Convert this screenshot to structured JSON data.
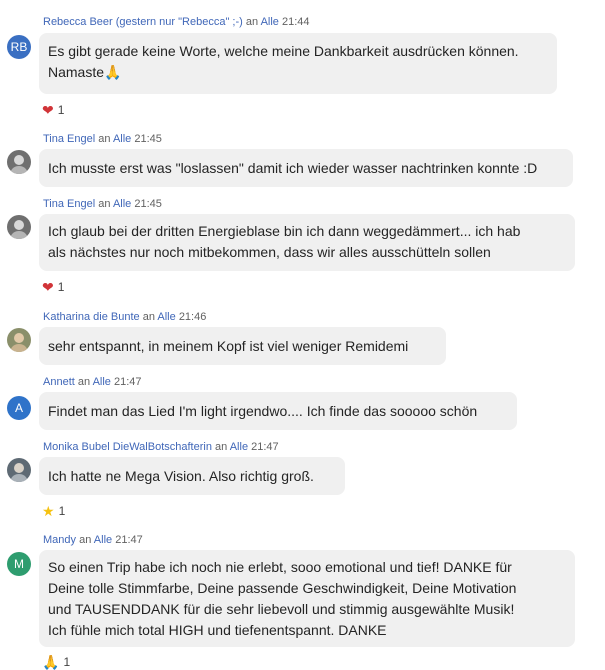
{
  "messages": [
    {
      "avatar_initials": "RB",
      "avatar_color": "#3a6fc2",
      "name": "Rebecca Beer (gestern nur \"Rebecca\" ;-)",
      "sep": "an",
      "audience": "Alle",
      "time": "21:44",
      "lines": [
        "Es gibt gerade keine Worte, welche meine Dankbarkeit ausdrücken können.",
        "Namaste🙏"
      ],
      "reaction_icon": "heart-icon",
      "reaction_glyph": "❤",
      "reaction_count": "1"
    },
    {
      "avatar_initials": "",
      "name": "Tina Engel",
      "sep": "an",
      "audience": "Alle",
      "time": "21:45",
      "lines": [
        "Ich musste erst was \"loslassen\" damit ich wieder wasser nachtrinken konnte :D"
      ]
    },
    {
      "avatar_initials": "",
      "name": "Tina Engel",
      "sep": "an",
      "audience": "Alle",
      "time": "21:45",
      "lines": [
        "Ich glaub bei der dritten Energieblase bin ich dann weggedämmert... ich hab",
        "als nächstes nur noch mitbekommen, dass wir alles ausschütteln sollen"
      ],
      "reaction_icon": "heart-icon",
      "reaction_glyph": "❤",
      "reaction_count": "1"
    },
    {
      "avatar_initials": "",
      "name": "Katharina die Bunte",
      "sep": "an",
      "audience": "Alle",
      "time": "21:46",
      "lines": [
        "sehr entspannt, in meinem Kopf ist viel weniger Remidemi"
      ]
    },
    {
      "avatar_initials": "A",
      "avatar_color": "#2f73c9",
      "name": "Annett",
      "sep": "an",
      "audience": "Alle",
      "time": "21:47",
      "lines": [
        "Findet man das Lied I'm light irgendwo.... Ich finde das sooooo schön"
      ]
    },
    {
      "avatar_initials": "",
      "name": "Monika Bubel DieWalBotschafterin",
      "sep": "an",
      "audience": "Alle",
      "time": "21:47",
      "lines": [
        "Ich hatte ne Mega Vision. Also richtig groß."
      ],
      "reaction_icon": "star-icon",
      "reaction_glyph": "★",
      "reaction_count": "1"
    },
    {
      "avatar_initials": "M",
      "avatar_color": "#2e9d6f",
      "name": "Mandy",
      "sep": "an",
      "audience": "Alle",
      "time": "21:47",
      "lines": [
        "So einen Trip habe ich noch nie erlebt, sooo emotional und tief! DANKE für",
        "Deine tolle Stimmfarbe, Deine passende Geschwindigkeit, Deine Motivation",
        "und TAUSENDDANK für die sehr liebevoll und stimmig ausgewählte Musik!",
        "Ich fühle mich total HIGH und tiefenentspannt. DANKE"
      ],
      "reaction_icon": "folded-hands-icon",
      "reaction_glyph": "🙏",
      "reaction_count": "1"
    }
  ]
}
